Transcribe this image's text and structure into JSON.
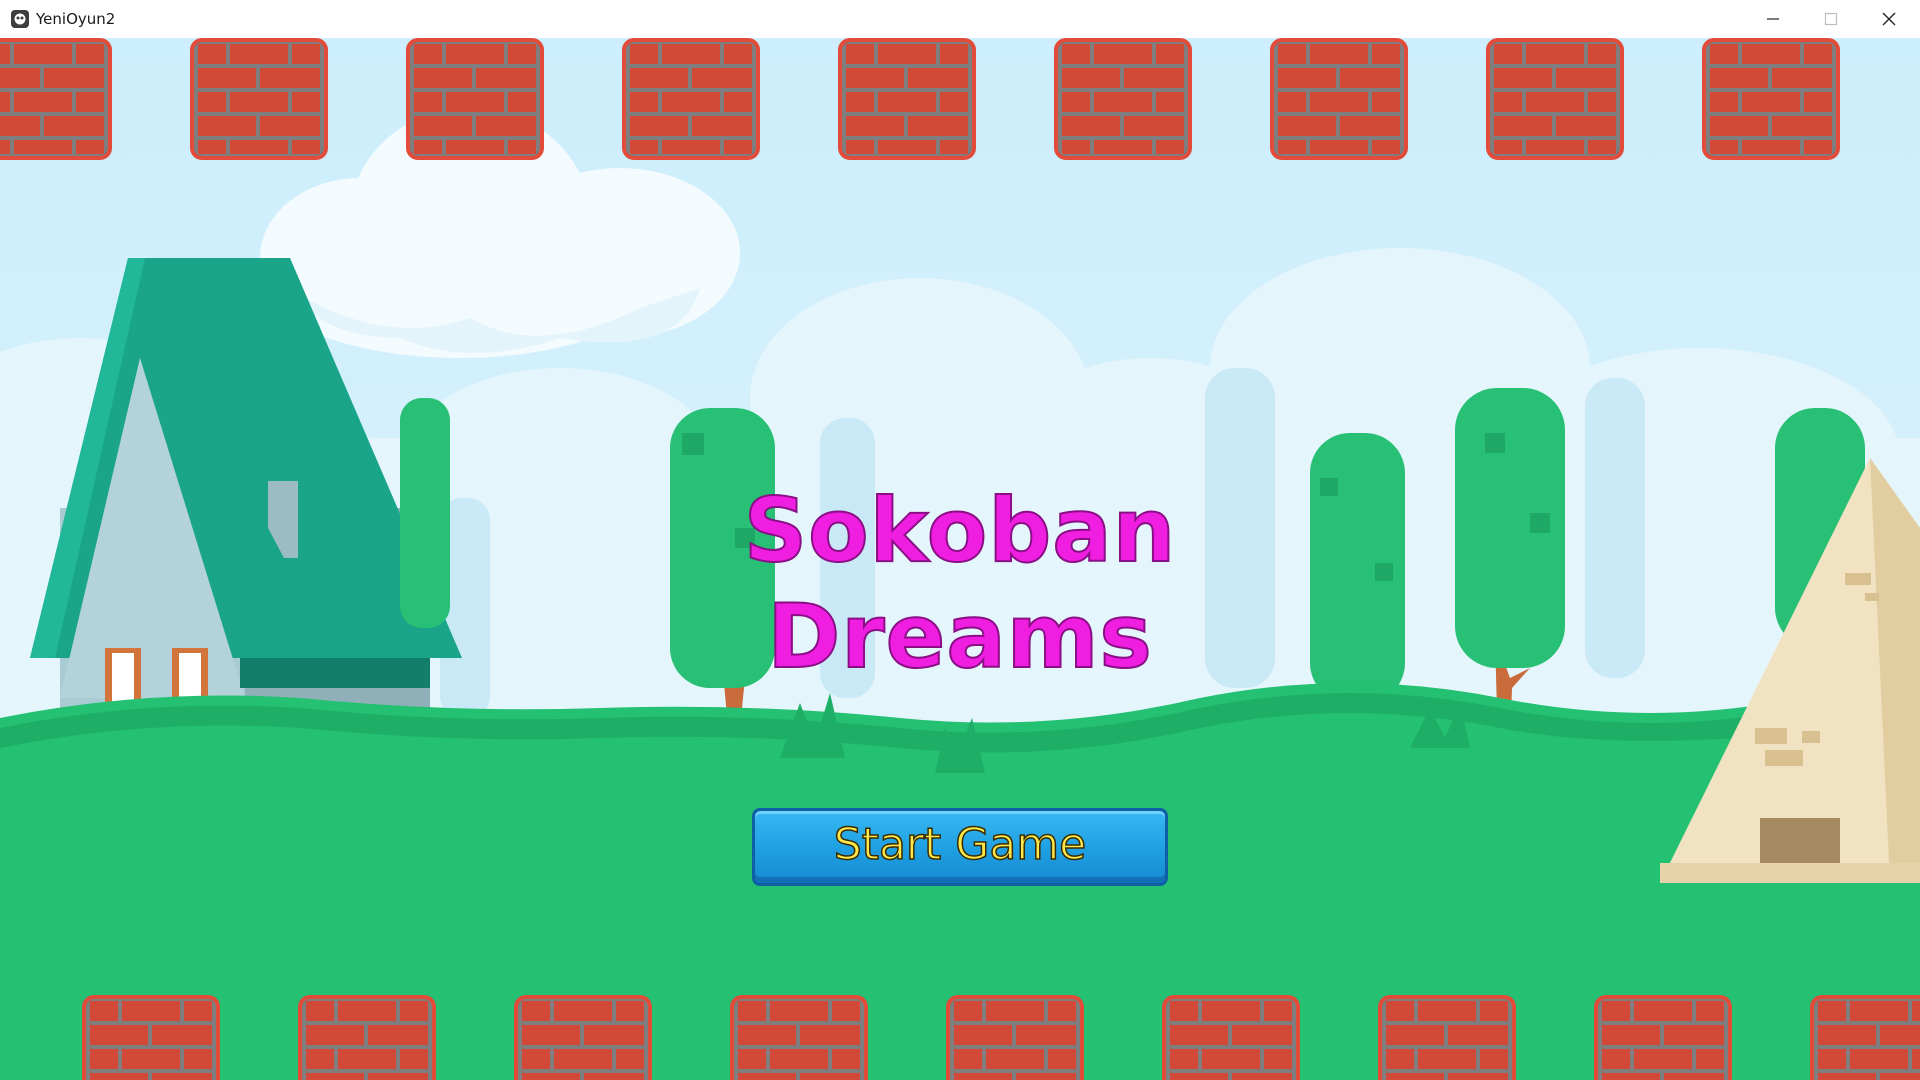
{
  "window": {
    "title": "YeniOyun2",
    "app_icon": "godot-engine-icon",
    "controls": [
      "minimize-icon",
      "maximize-icon",
      "close-icon"
    ]
  },
  "game": {
    "title_line1": "Sokoban",
    "title_line2": "Dreams",
    "start_button_label": "Start Game",
    "colors": {
      "title": "#f01ee0",
      "button": "#1e9fe2",
      "button_text": "#ffe94a",
      "grass": "#25c172",
      "sky": "#cdeefc",
      "brick": "#d24a37"
    }
  }
}
